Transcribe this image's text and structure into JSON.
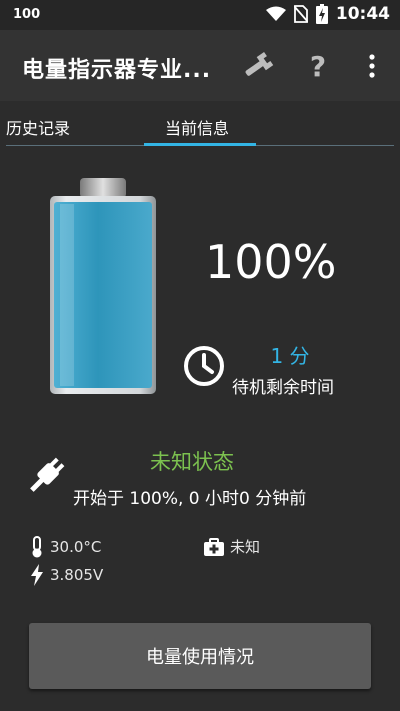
{
  "status_bar": {
    "left_text": "100",
    "time": "10:44",
    "icons": [
      "wifi-icon",
      "no-sim-icon",
      "battery-charging-icon"
    ]
  },
  "app_bar": {
    "title": "电量指示器专业...",
    "icons": [
      "wrench-icon",
      "help-icon",
      "overflow-menu-icon"
    ],
    "help_glyph": "?"
  },
  "tabs": [
    {
      "label": "历史记录",
      "selected": false
    },
    {
      "label": "当前信息",
      "selected": true
    }
  ],
  "battery": {
    "level_percent": 100,
    "percent_text": "100%",
    "fill_color": "#2e95ba"
  },
  "estimate": {
    "value": "1 分",
    "label": "待机剩余时间"
  },
  "state": {
    "title": "未知状态",
    "subtitle": "开始于 100%, 0 小时0 分钟前"
  },
  "details": {
    "temperature": "30.0°C",
    "health": "未知",
    "voltage": "3.805V"
  },
  "usage_button": {
    "label": "电量使用情况"
  },
  "colors": {
    "accent": "#33b5e5",
    "state_green": "#7cc14f",
    "background": "#2c2c2c",
    "app_bar": "#333333"
  }
}
